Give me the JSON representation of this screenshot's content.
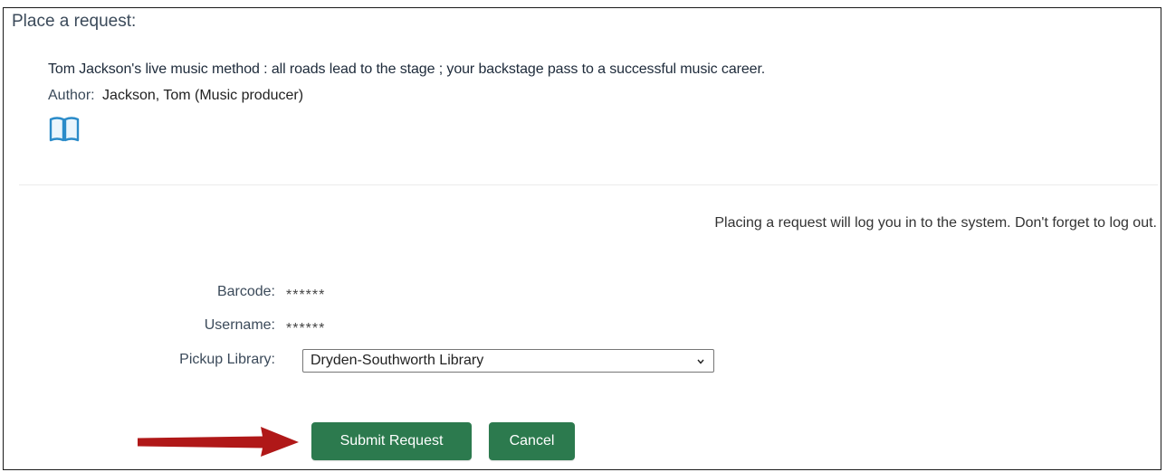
{
  "page": {
    "heading": "Place a request:"
  },
  "item": {
    "title": "Tom Jackson's live music method : all roads lead to the stage ; your backstage pass to a successful music career.",
    "author_label": "Author:",
    "author_value": "Jackson, Tom (Music producer)",
    "format_icon": "book-icon"
  },
  "notice": "Placing a request will log you in to the system. Don't forget to log out.",
  "form": {
    "barcode_label": "Barcode:",
    "barcode_value": "******",
    "username_label": "Username:",
    "username_value": "******",
    "pickup_label": "Pickup Library:",
    "pickup_selected": "Dryden-Southworth Library"
  },
  "buttons": {
    "submit_label": "Submit Request",
    "cancel_label": "Cancel"
  },
  "colors": {
    "button_green": "#2c7a4e",
    "arrow_red": "#b01818",
    "icon_blue": "#2a8bc9"
  }
}
